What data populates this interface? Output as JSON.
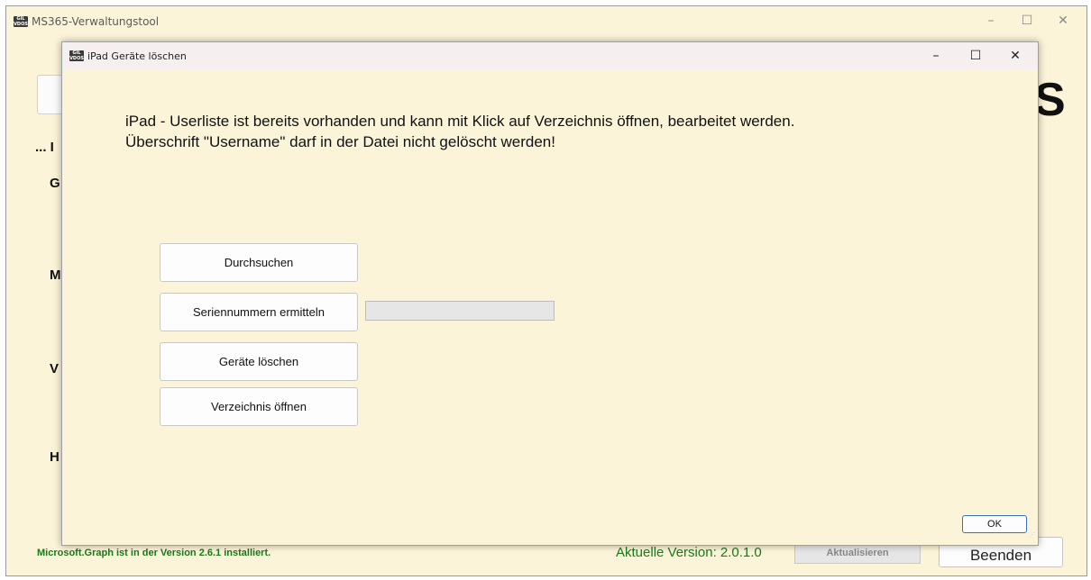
{
  "main_window": {
    "title": "MS365-Verwaltungstool",
    "icon_text": "ĞİL VDOS",
    "controls": {
      "minimize": "–",
      "maximize": "☐",
      "close": "✕"
    },
    "background": {
      "side_letters": [
        "... I",
        "G",
        "M",
        "V",
        "H"
      ],
      "big_letter": "S",
      "status_text": "Microsoft.Graph ist in der Version 2.6.1 installiert.",
      "version_text": "Aktuelle Version: 2.0.1.0",
      "update_button": "Aktualisieren",
      "exit_button": "Beenden"
    }
  },
  "dialog": {
    "title": "iPad Geräte löschen",
    "controls": {
      "minimize": "–",
      "maximize": "☐",
      "close": "✕"
    },
    "message_line1": "iPad - Userliste ist bereits vorhanden und kann mit Klick auf Verzeichnis öffnen, bearbeitet werden.",
    "message_line2": "Überschrift \"Username\" darf in der Datei nicht gelöscht werden!",
    "buttons": {
      "browse": "Durchsuchen",
      "get_serials": "Seriennummern ermitteln",
      "delete_devices": "Geräte löschen",
      "open_directory": "Verzeichnis öffnen"
    },
    "progress": 0,
    "ok_button": "OK"
  },
  "colors": {
    "background": "#fcf4d8",
    "status_green": "#1a7a1a",
    "accent": "#3a6fc4"
  }
}
